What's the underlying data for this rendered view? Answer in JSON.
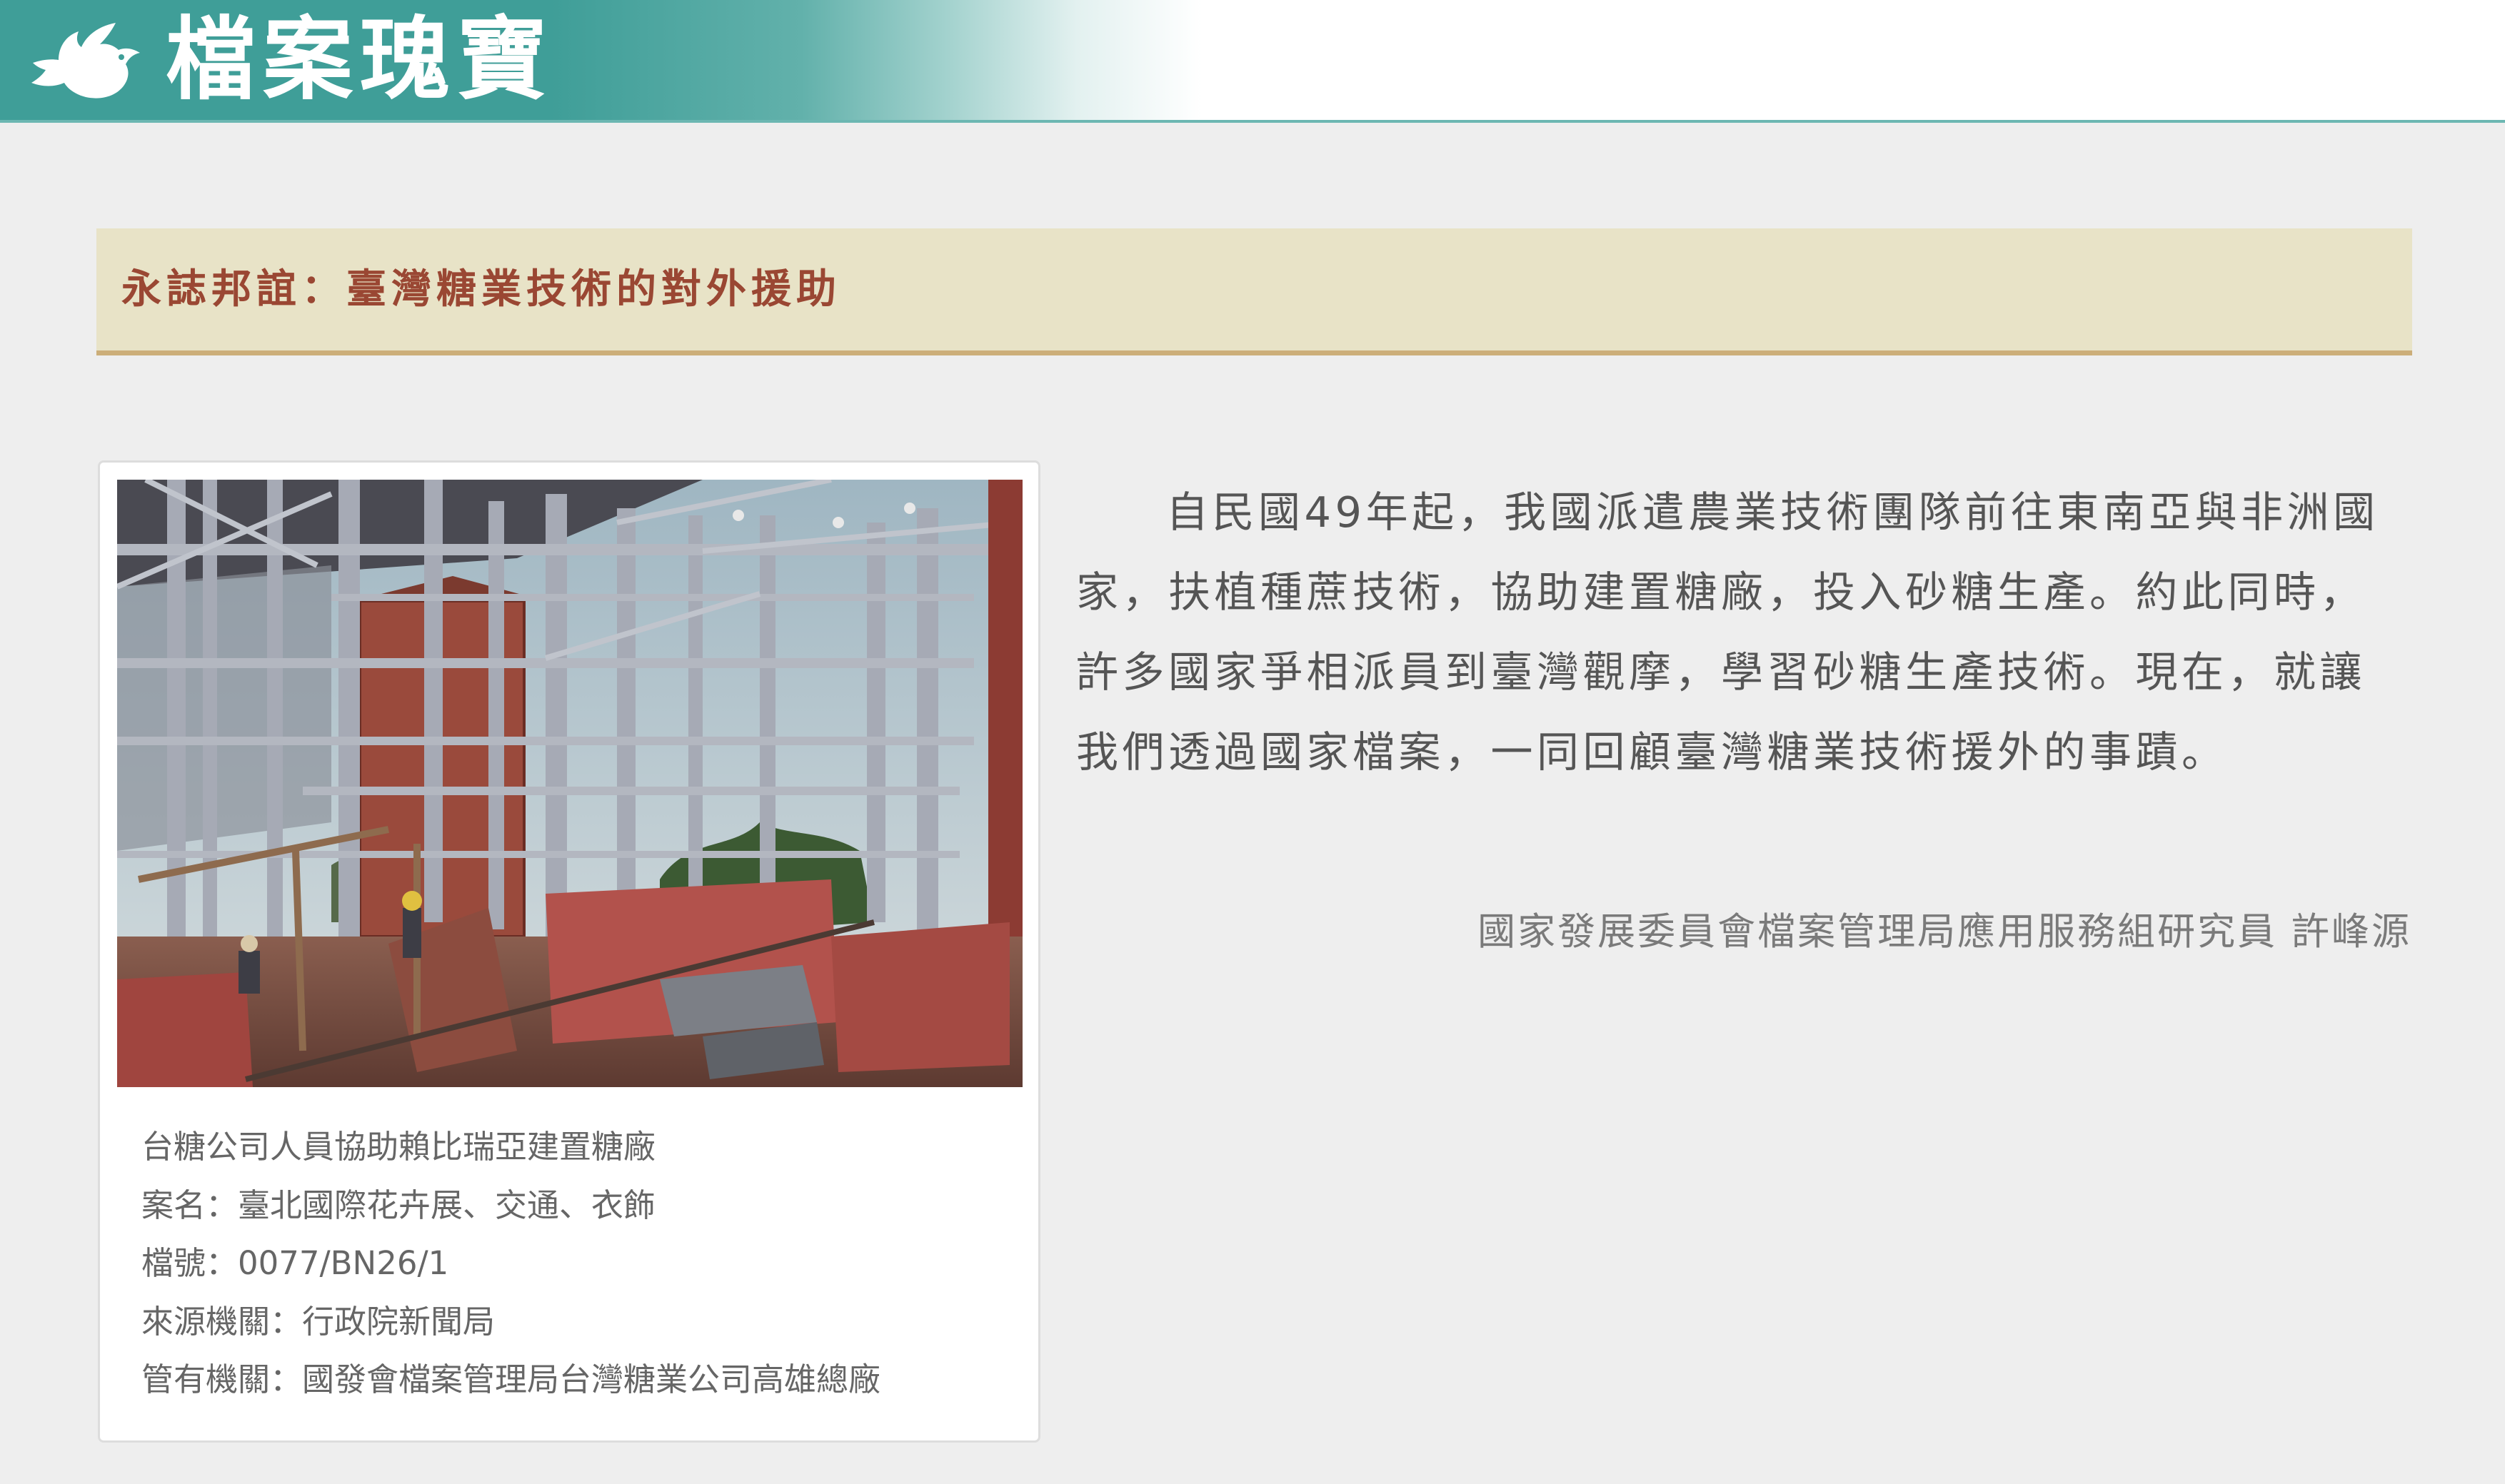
{
  "header": {
    "site_title": "檔案瑰寶",
    "logo_icon": "dove-icon",
    "colors": {
      "teal": "#3f9e98",
      "white": "#ffffff"
    }
  },
  "page": {
    "title": "永誌邦誼：臺灣糖業技術的對外援助",
    "title_color": "#9a4733",
    "band_color": "#e8e3c7",
    "band_border_color": "#ccae79"
  },
  "photo": {
    "description": "台糖公司人員協助賴比瑞亞建置糖廠",
    "case_name": "案名：臺北國際花卉展、交通、衣飾",
    "file_number": "檔號：0077/BN26/1",
    "source_agency": "來源機關：行政院新聞局",
    "custodian": "管有機關：國發會檔案管理局台灣糖業公司高雄總廠"
  },
  "intro": {
    "text": "自民國49年起，我國派遣農業技術團隊前往東南亞與非洲國家，扶植種蔗技術，協助建置糖廠，投入砂糖生產。約此同時，許多國家爭相派員到臺灣觀摩，學習砂糖生產技術。現在，就讓我們透過國家檔案，一同回顧臺灣糖業技術援外的事蹟。",
    "author": "國家發展委員會檔案管理局應用服務組研究員 許峰源"
  }
}
